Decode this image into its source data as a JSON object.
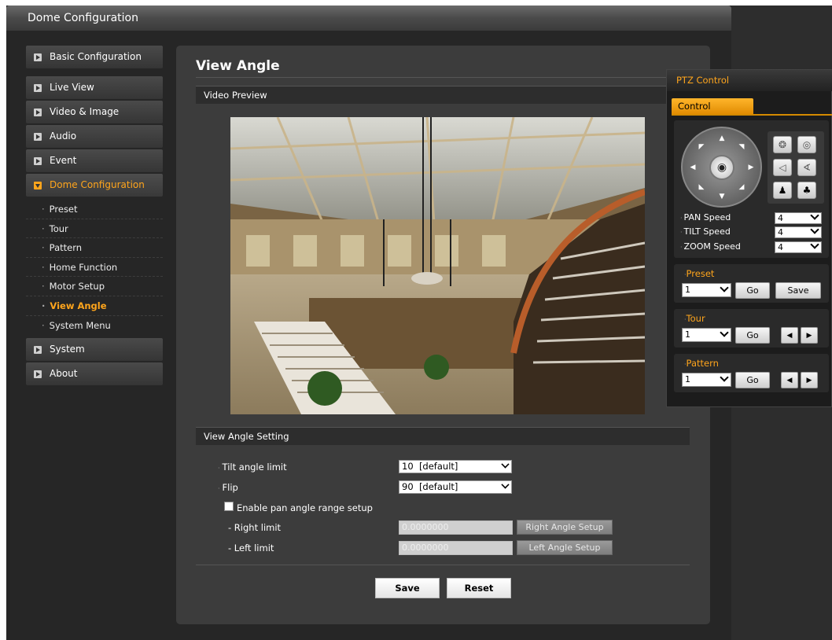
{
  "window": {
    "title": "Dome Configuration"
  },
  "sidebar": {
    "items": [
      {
        "label": "Basic Configuration"
      },
      {
        "label": "Live View"
      },
      {
        "label": "Video & Image"
      },
      {
        "label": "Audio"
      },
      {
        "label": "Event"
      },
      {
        "label": "Dome Configuration",
        "active": true
      },
      {
        "label": "System"
      },
      {
        "label": "About"
      }
    ],
    "submenu": [
      {
        "label": "Preset"
      },
      {
        "label": "Tour"
      },
      {
        "label": "Pattern"
      },
      {
        "label": "Home Function"
      },
      {
        "label": "Motor Setup"
      },
      {
        "label": "View Angle",
        "current": true
      },
      {
        "label": "System Menu"
      }
    ],
    "sub_bullet": "·"
  },
  "main": {
    "title": "View Angle",
    "preview_section": "Video Preview",
    "setting_section": "View Angle Setting",
    "form": {
      "tilt_label": "Tilt angle limit",
      "tilt_value": "10  [default]",
      "flip_label": "Flip",
      "flip_value": "90  [default]",
      "pan_checkbox_label": "Enable pan angle range setup",
      "right_limit_label": "- Right limit",
      "right_limit_value": "0.0000000",
      "right_setup_button": "Right Angle Setup",
      "left_limit_label": "- Left limit",
      "left_limit_value": "0.0000000",
      "left_setup_button": "Left Angle Setup"
    },
    "save_button": "Save",
    "reset_button": "Reset"
  },
  "ptz": {
    "title": "PTZ Control",
    "tab": "Control",
    "pan_speed_label": "PAN Speed",
    "pan_speed_value": "4",
    "tilt_speed_label": "TILT Speed",
    "tilt_speed_value": "4",
    "zoom_speed_label": "ZOOM Speed",
    "zoom_speed_value": "4",
    "preset": {
      "label": "Preset",
      "value": "1",
      "go": "Go",
      "save": "Save"
    },
    "tour": {
      "label": "Tour",
      "value": "1",
      "go": "Go"
    },
    "pattern": {
      "label": "Pattern",
      "value": "1",
      "go": "Go"
    }
  },
  "colors": {
    "accent": "#ffa51c",
    "background": "#262626",
    "panel": "#3c3c3c"
  },
  "icons": [
    "menu-arrow-icon",
    "chevron-down-icon",
    "joystick-icon",
    "focus-icon",
    "iris-icon",
    "zoom-icon",
    "person-icon",
    "group-icon",
    "arrow-left-icon",
    "arrow-right-icon"
  ]
}
